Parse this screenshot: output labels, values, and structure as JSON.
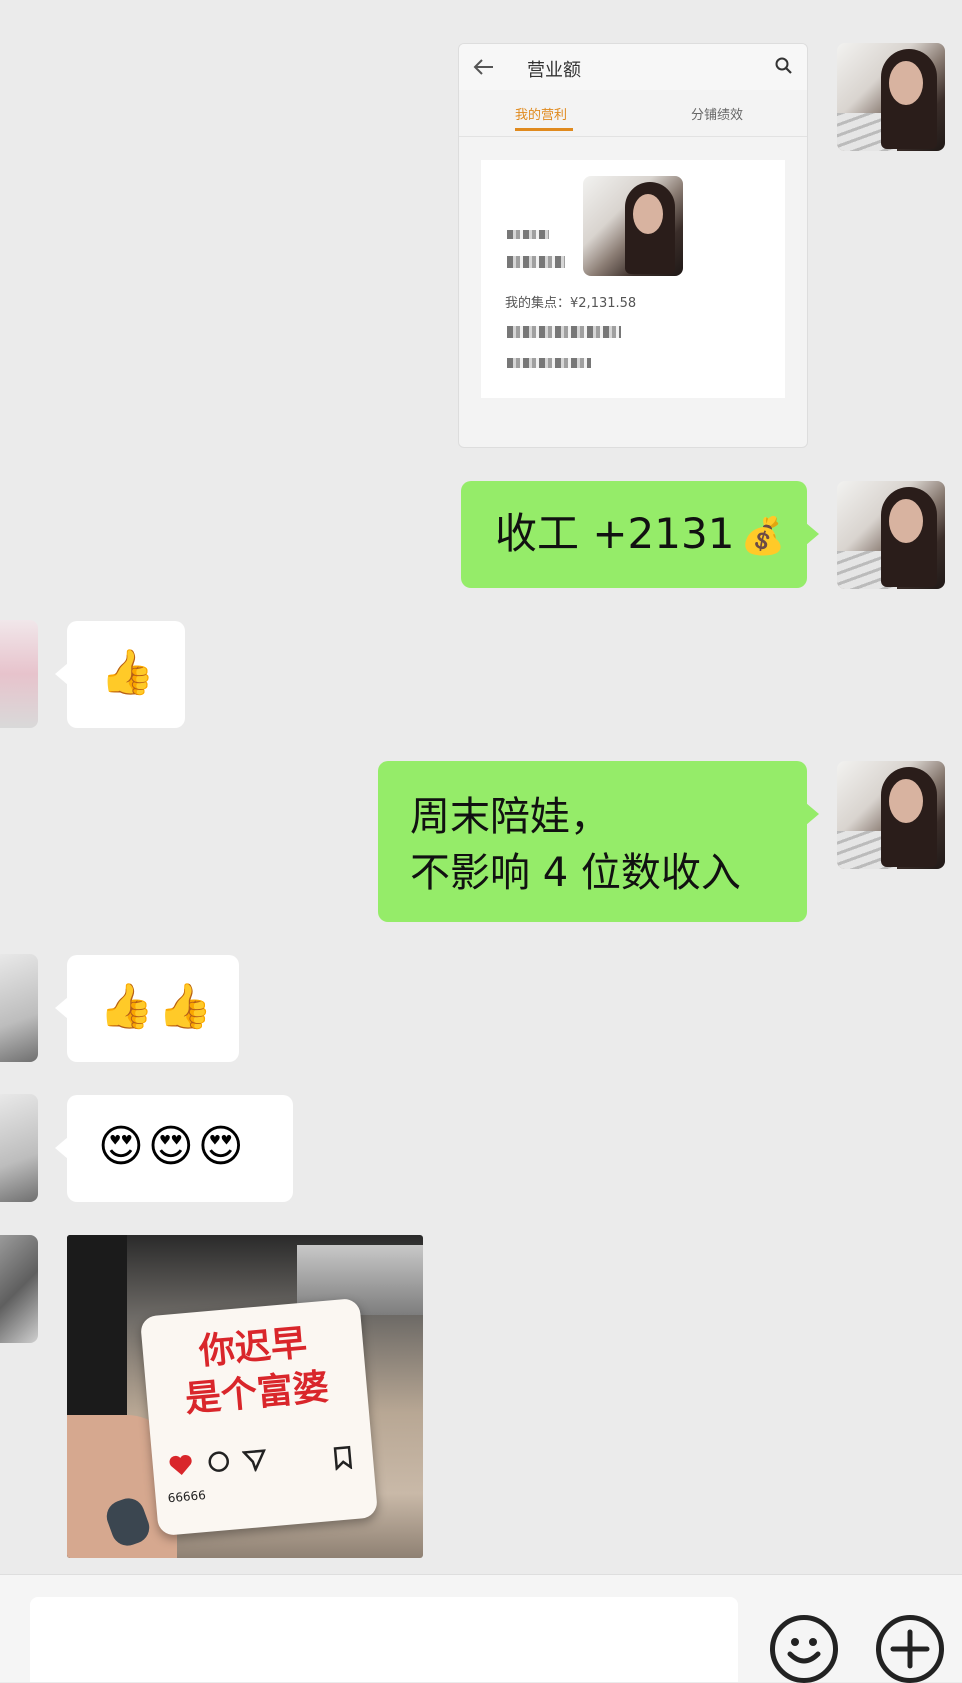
{
  "shot": {
    "title": "营业额",
    "tab_active": "我的营利",
    "tab_other": "分铺绩效",
    "points_label": "我的集点：",
    "points_value": "¥2,131.58",
    "accent_color": "#e08a1e"
  },
  "messages": {
    "msg1": "收工 +2131",
    "msg1_emoji": "💰",
    "reply1": "👍",
    "msg2_line1": "周末陪娃，",
    "msg2_line2": "不影响 4 位数收入",
    "reply2": "👍👍",
    "reply3": "😍😍😍"
  },
  "photo": {
    "line1": "你迟早",
    "line2": "是个富婆",
    "likes": "66666"
  },
  "colors": {
    "bubble_green": "#95ec69",
    "chat_bg": "#ebebeb",
    "text_red": "#d9262b"
  },
  "icons": {
    "back": "arrow-left-icon",
    "search": "search-icon",
    "emoji": "emoji-icon",
    "plus": "plus-icon"
  }
}
